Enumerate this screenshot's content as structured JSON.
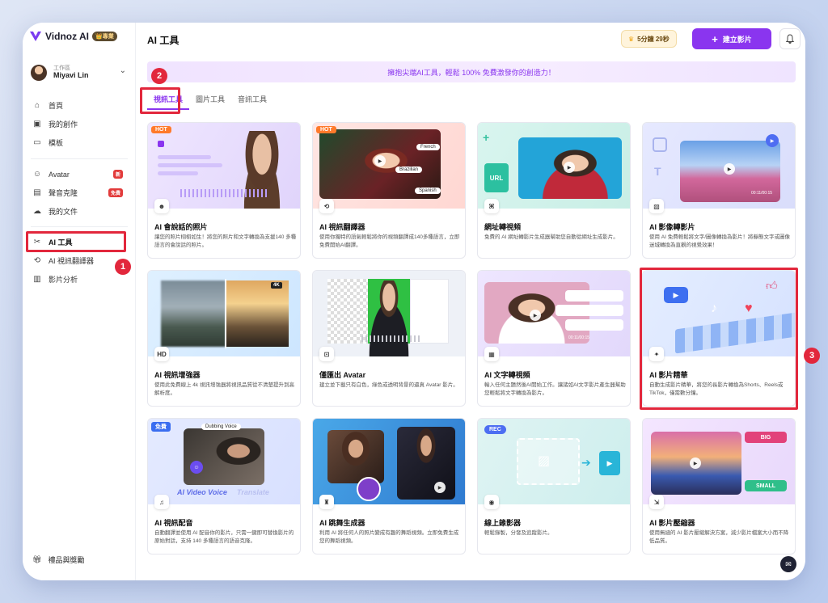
{
  "app": {
    "logo_text": "Vidnoz AI",
    "pro_badge": "👑專業"
  },
  "workspace": {
    "label": "工作區",
    "user": "Miyavi Lin"
  },
  "sidebar": {
    "group1": [
      {
        "label": "首頁",
        "icon": "home-icon"
      },
      {
        "label": "我的創作",
        "icon": "play-square-icon"
      },
      {
        "label": "模板",
        "icon": "template-icon"
      }
    ],
    "group2": [
      {
        "label": "Avatar",
        "icon": "user-card-icon",
        "tag": "新"
      },
      {
        "label": "聲音克隆",
        "icon": "voice-clone-icon",
        "tag": "免費"
      },
      {
        "label": "我的文件",
        "icon": "cloud-upload-icon"
      }
    ],
    "group3": [
      {
        "label": "AI 工具",
        "icon": "tools-icon"
      },
      {
        "label": "AI 視訊翻譯器",
        "icon": "translate-icon"
      },
      {
        "label": "影片分析",
        "icon": "analytics-icon"
      }
    ],
    "gift": "禮品與獎勵"
  },
  "header": {
    "title": "AI 工具",
    "minutes": "5分鐘 29秒",
    "create_button": "建立影片"
  },
  "banner": "擁抱尖端AI工具，輕鬆 100% 免費激發你的創造力！",
  "tabs": [
    "視訊工具",
    "圖片工具",
    "音訊工具"
  ],
  "steps": [
    "1",
    "2",
    "3"
  ],
  "cards": [
    {
      "title": "AI 會說話的照片",
      "desc": "讓您的照片栩栩如生！將您的照片和文字轉換為支援140 多種語言的會說話的照片。",
      "badge": "HOT",
      "icon": "talking-photo-icon"
    },
    {
      "title": "AI 視訊翻譯器",
      "desc": "使用你獨特的語氣輕鬆將你的視頻翻譯成140多種語言，立即免費開始AI翻譯。",
      "badge": "HOT",
      "icon": "video-translate-icon",
      "langs": [
        "French",
        "Brazilian",
        "Spanish"
      ]
    },
    {
      "title": "網址轉視頻",
      "desc": "免費的 AI 網址轉影片生成器幫助您自動從網址生成影片。",
      "icon": "url-icon",
      "url_label": "URL"
    },
    {
      "title": "AI 影像轉影片",
      "desc": "使用 AI 免費輕鬆將文字/圖像轉換為影片！將靜態文字或圖像迷城轉換為直觀的視覺效果！",
      "icon": "image-to-video-icon",
      "time": "00:11/00:15"
    },
    {
      "title": "AI 視訊增強器",
      "desc": "使用此免費線上 4k 視訊增強器將視訊品質從不清楚提升到高解析度。",
      "icon": "hd-icon",
      "res": "4K",
      "icon_text": "HD"
    },
    {
      "title": "僅匯出 Avatar",
      "desc": "建立並下載只有白色，綠色或透明背景的逼真 Avatar 影片。",
      "icon": "avatar-export-icon"
    },
    {
      "title": "AI 文字轉視頻",
      "desc": "輸入任何主題然後AI開始工作。讓諸如AI文字影片產生器幫助您輕鬆將文字轉換為影片。",
      "icon": "text-to-video-icon",
      "time": "00:11/00:15"
    },
    {
      "title": "AI 影片精華",
      "desc": "自動生成影片精華，將您的長影片轉換為Shorts、Reels或TikTok，僅需數分鐘。",
      "icon": "highlight-icon"
    },
    {
      "title": "AI 視訊配音",
      "desc": "自動翻譯並使用 AI 配音你的影片，只需一鍵即可替換影片的原始對話，支持 140 多種語言的語音克隆。",
      "badge": "免費",
      "icon": "mic-icon",
      "overlay": "AI Video Voice",
      "overlay2": "Translate",
      "dubbing": "Dubbing Voice"
    },
    {
      "title": "AI 跳舞生成器",
      "desc": "利用 AI 將任何人的照片變成有趣的舞蹈視頻。立即免費生成您的舞蹈視頻。",
      "icon": "dance-icon"
    },
    {
      "title": "線上錄影器",
      "desc": "輕鬆錄製，分發及追蹤影片。",
      "icon": "recorder-icon",
      "rec": "REC"
    },
    {
      "title": "AI 影片壓縮器",
      "desc": "使用無縫的 AI 影片壓縮解決方案，減少影片檔案大小而不降低品質。",
      "icon": "compress-icon",
      "big": "BIG",
      "small": "SMALL"
    }
  ],
  "colors": {
    "accent": "#8a35ef",
    "highlight": "#e2273c",
    "hot": "#ff7a2b"
  }
}
